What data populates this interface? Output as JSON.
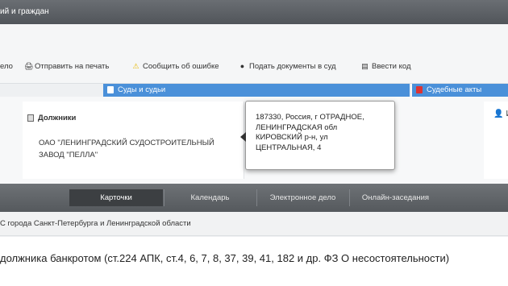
{
  "header": {
    "title": "ий и граждан"
  },
  "toolbar": {
    "items": [
      {
        "label": "ело",
        "icon": ""
      },
      {
        "label": "Отправить на печать",
        "icon": "printer-icon"
      },
      {
        "label": "Сообщить об ошибке",
        "icon": "warning-icon"
      },
      {
        "label": "Подать документы в суд",
        "icon": "upload-icon"
      },
      {
        "label": "Ввести код",
        "icon": "code-icon"
      }
    ]
  },
  "sections": {
    "left": "Суды и судьи",
    "right": "Судебные акты"
  },
  "debtor": {
    "heading": "Должники",
    "name": "ОАО \"ЛЕНИНГРАДСКИЙ СУДОСТРОИТЕЛЬНЫЙ ЗАВОД \"ПЕЛЛА\""
  },
  "tooltip": {
    "address": "187330, Россия, г ОТРАДНОЕ, ЛЕНИНГРАДСКАЯ обл КИРОВСКИЙ р-н, ул ЦЕНТРАЛЬНАЯ, 4"
  },
  "right_panel": {
    "label": "И"
  },
  "nav": {
    "tabs": [
      {
        "label": "Карточки",
        "active": true
      },
      {
        "label": "Календарь",
        "active": false
      },
      {
        "label": "Электронное дело",
        "active": false
      },
      {
        "label": "Онлайн-заседания",
        "active": false
      }
    ]
  },
  "court": {
    "name": "С города Санкт-Петербурга и Ленинградской области"
  },
  "case": {
    "description": "должника банкротом (ст.224 АПК, ст.4, 6, 7, 8, 37, 39, 41, 182 и др. ФЗ О несостоятельности)"
  }
}
